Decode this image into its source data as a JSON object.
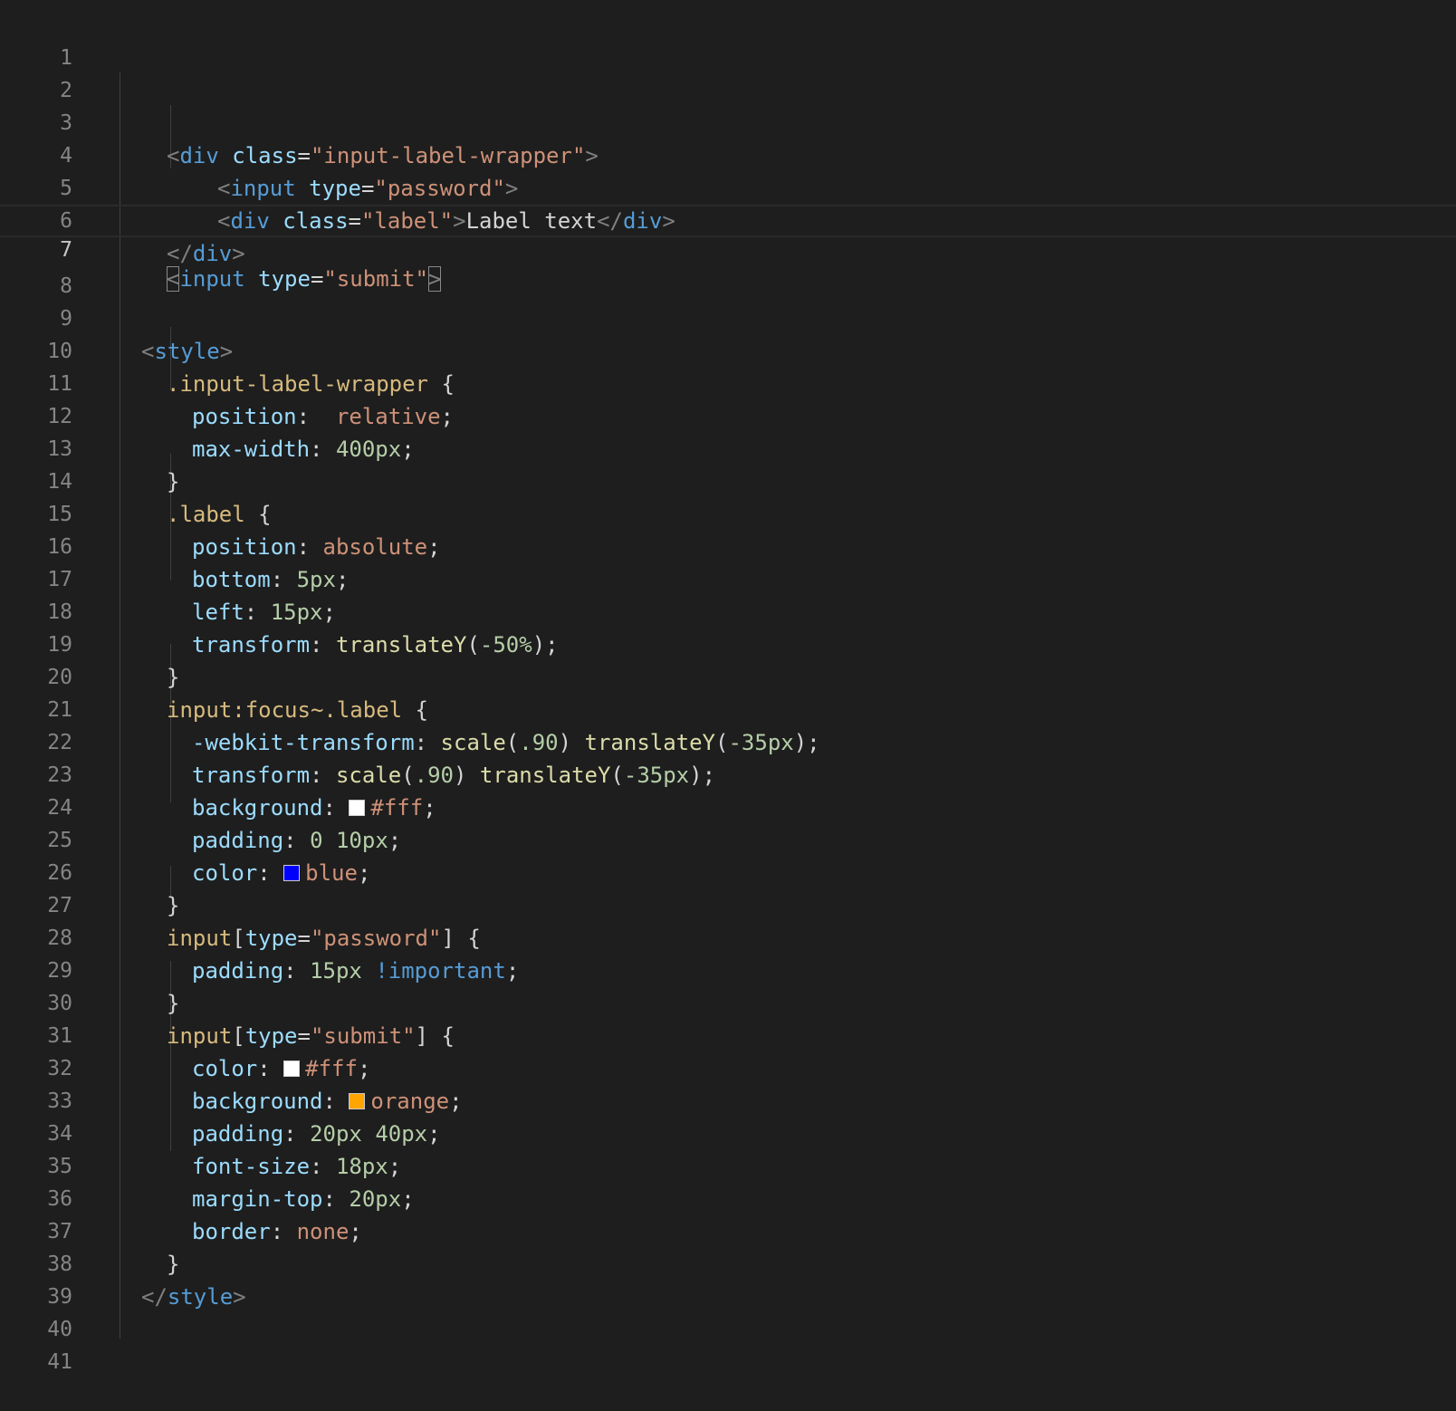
{
  "editor": {
    "lines": [
      {
        "n": "1"
      },
      {
        "n": "2"
      },
      {
        "n": "3"
      },
      {
        "n": "4"
      },
      {
        "n": "5"
      },
      {
        "n": "6"
      },
      {
        "n": "7"
      },
      {
        "n": "8"
      },
      {
        "n": "9"
      },
      {
        "n": "10"
      },
      {
        "n": "11"
      },
      {
        "n": "12"
      },
      {
        "n": "13"
      },
      {
        "n": "14"
      },
      {
        "n": "15"
      },
      {
        "n": "16"
      },
      {
        "n": "17"
      },
      {
        "n": "18"
      },
      {
        "n": "19"
      },
      {
        "n": "20"
      },
      {
        "n": "21"
      },
      {
        "n": "22"
      },
      {
        "n": "23"
      },
      {
        "n": "24"
      },
      {
        "n": "25"
      },
      {
        "n": "26"
      },
      {
        "n": "27"
      },
      {
        "n": "28"
      },
      {
        "n": "29"
      },
      {
        "n": "30"
      },
      {
        "n": "31"
      },
      {
        "n": "32"
      },
      {
        "n": "33"
      },
      {
        "n": "34"
      },
      {
        "n": "35"
      },
      {
        "n": "36"
      },
      {
        "n": "37"
      },
      {
        "n": "38"
      },
      {
        "n": "39"
      },
      {
        "n": "40"
      },
      {
        "n": "41"
      }
    ],
    "tokens": {
      "lt": "<",
      "gt": ">",
      "lts": "</",
      "eq": "=",
      "semi": ";",
      "colon": ":",
      "ob": "{",
      "cb": "}",
      "lp": "(",
      "rp": ")",
      "lbr": "[",
      "rbr": "]",
      "div": "div",
      "input": "input",
      "style": "style",
      "class": "class",
      "type": "type",
      "s_wrapper": "\"input-label-wrapper\"",
      "s_password": "\"password\"",
      "s_label": "\"label\"",
      "s_submit": "\"submit\"",
      "label_text": "Label text",
      "sel_wrapper": ".input-label-wrapper",
      "sel_label": ".label",
      "sel_focus": "input:focus~.label",
      "sel_input": "input",
      "position": "position",
      "max_width": "max-width",
      "bottom": "bottom",
      "left": "left",
      "transform": "transform",
      "webkit_transform": "-webkit-transform",
      "background": "background",
      "padding": "padding",
      "color": "color",
      "font_size": "font-size",
      "margin_top": "margin-top",
      "border": "border",
      "relative": "relative",
      "absolute": "absolute",
      "none": "none",
      "blue": "blue",
      "orange": "orange",
      "fff": "#fff",
      "translateY": "translateY",
      "scale": "scale",
      "v400px": "400px",
      "v5px": "5px",
      "v15px": "15px",
      "vneg50": "-50%",
      "v90": ".90",
      "vneg35": "-35px",
      "v0": "0",
      "v10px": "10px",
      "v20px": "20px",
      "v40px": "40px",
      "v18px": "18px",
      "important": "!important"
    },
    "swatch_colors": {
      "white": "#ffffff",
      "blue": "#0000ff",
      "orange": "#ffa500"
    }
  }
}
